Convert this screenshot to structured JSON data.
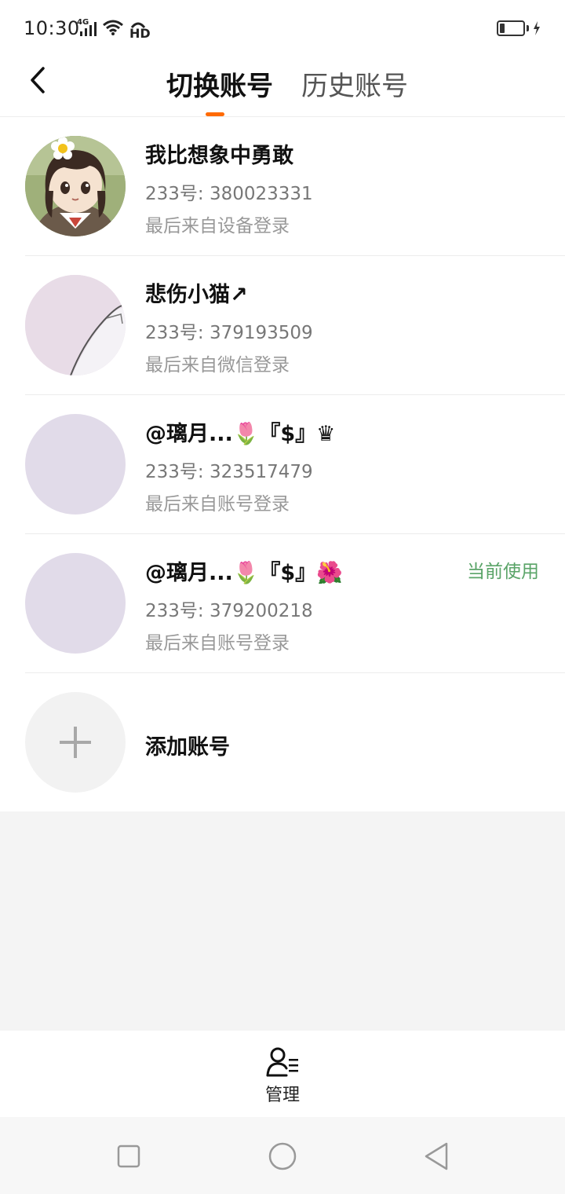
{
  "status_bar": {
    "time": "10:30",
    "network": "4G",
    "hd": "HD",
    "battery_percent": 20
  },
  "header": {
    "back_icon": "chevron-left-icon",
    "tabs": [
      {
        "label": "切换账号",
        "active": true
      },
      {
        "label": "历史账号",
        "active": false
      }
    ],
    "indicator_color": "#ff6a00"
  },
  "accounts": [
    {
      "name": "我比想象中勇敢",
      "id": "233号: 380023331",
      "login": "最后来自设备登录",
      "current": ""
    },
    {
      "name": "悲伤小猫↗",
      "id": "233号: 379193509",
      "login": "最后来自微信登录",
      "current": ""
    },
    {
      "name": "@璃月...🌷『$』♛",
      "id": "233号: 323517479",
      "login": "最后来自账号登录",
      "current": ""
    },
    {
      "name": "@璃月...🌷『$』🌺",
      "id": "233号: 379200218",
      "login": "最后来自账号登录",
      "current": "当前使用"
    }
  ],
  "add_account": {
    "label": "添加账号",
    "icon": "plus-icon"
  },
  "bottom_bar": {
    "manage_label": "管理",
    "manage_icon": "user-list-icon"
  },
  "system_nav": {
    "recent": "square-icon",
    "home": "circle-icon",
    "back": "triangle-back-icon"
  },
  "colors": {
    "accent": "#ff6a00",
    "current_badge": "#5aa468",
    "avatar_placeholder": "#e1dbe9"
  }
}
